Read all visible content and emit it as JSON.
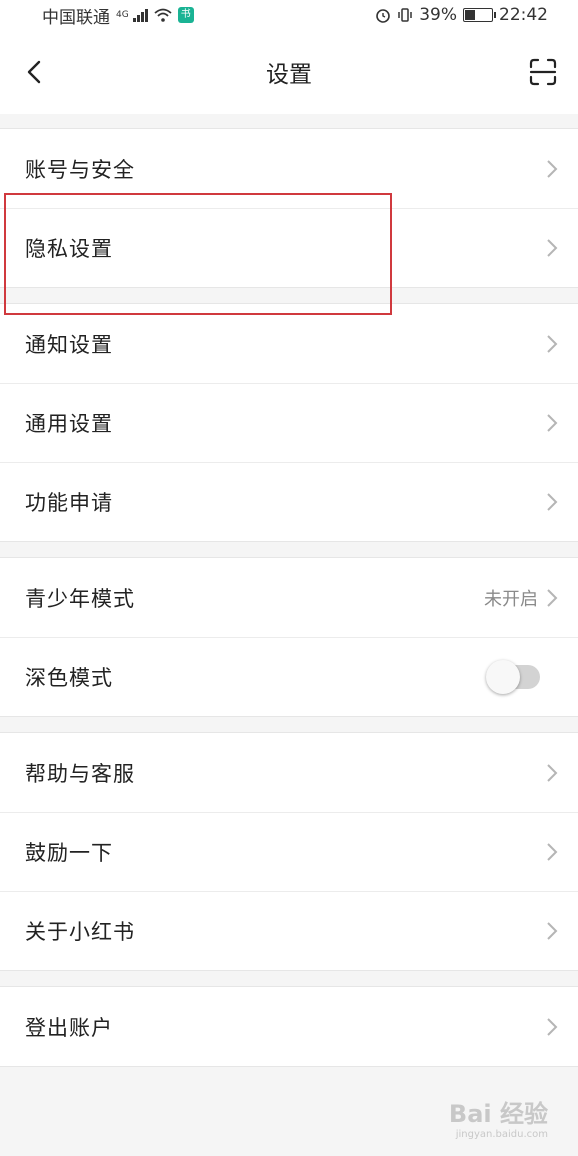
{
  "status_bar": {
    "carrier": "中国联通",
    "network_tag": "4G",
    "battery_percent": "39%",
    "battery_level": 0.39,
    "time": "22:42",
    "icons": [
      "signal-icon",
      "wifi-icon",
      "app-notification-icon",
      "alarm-icon",
      "vibrate-icon",
      "battery-icon"
    ]
  },
  "nav": {
    "title": "设置",
    "back_icon": "back-arrow-icon",
    "scan_icon": "scan-icon"
  },
  "groups": [
    {
      "items": [
        {
          "label": "账号与安全"
        },
        {
          "label": "隐私设置"
        }
      ]
    },
    {
      "items": [
        {
          "label": "通知设置"
        },
        {
          "label": "通用设置"
        },
        {
          "label": "功能申请"
        }
      ]
    },
    {
      "items": [
        {
          "label": "青少年模式",
          "value": "未开启"
        },
        {
          "label": "深色模式",
          "toggle": false
        }
      ]
    },
    {
      "items": [
        {
          "label": "帮助与客服"
        },
        {
          "label": "鼓励一下"
        },
        {
          "label": "关于小红书"
        }
      ]
    },
    {
      "items": [
        {
          "label": "登出账户"
        }
      ]
    }
  ],
  "colors": {
    "highlight_border": "#d0393e",
    "background": "#f5f5f5",
    "toggle_off": "#d3d3d3"
  },
  "watermark": {
    "main": "Bai 经验",
    "sub": "jingyan.baidu.com"
  }
}
